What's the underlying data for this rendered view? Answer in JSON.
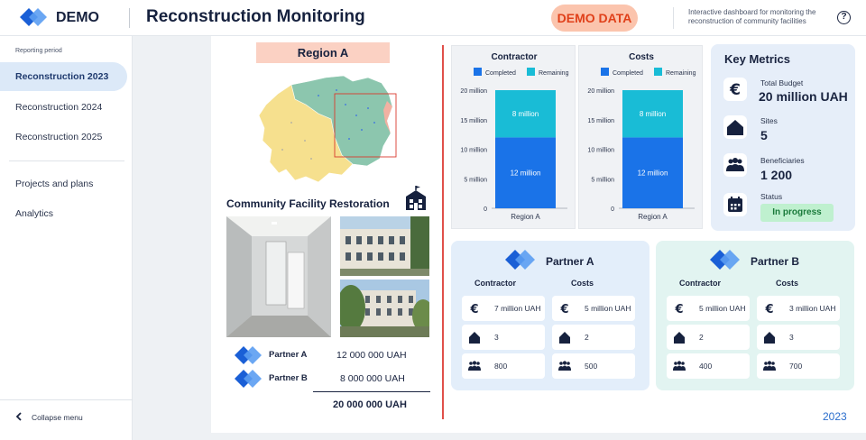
{
  "header": {
    "brand": "DEMO",
    "title": "Reconstruction Monitoring",
    "badge": "DEMO DATA",
    "subtitle": "Interactive dashboard for monitoring the reconstruction of community facilities",
    "help": "?"
  },
  "sidebar": {
    "section_label": "Reporting period",
    "items": [
      {
        "label": "Reconstruction 2023",
        "active": true
      },
      {
        "label": "Reconstruction 2024"
      },
      {
        "label": "Reconstruction 2025"
      }
    ],
    "links": [
      {
        "label": "Projects and plans"
      },
      {
        "label": "Analytics"
      }
    ],
    "collapse_label": "Collapse menu"
  },
  "region": {
    "label": "Region A"
  },
  "facility": {
    "title": "Community Facility Restoration"
  },
  "funding": {
    "rows": [
      {
        "partner": "Partner A",
        "amount": "12 000 000 UAH"
      },
      {
        "partner": "Partner B",
        "amount": "8 000 000 UAH"
      }
    ],
    "total": "20 000 000 UAH"
  },
  "colors": {
    "completed": "#1a73e8",
    "remaining": "#19bcd6",
    "accent": "#2b6ecd",
    "badge": "#e0401a"
  },
  "chart_data": [
    {
      "type": "bar",
      "title": "Contractor",
      "categories": [
        "Region A"
      ],
      "series": [
        {
          "name": "Completed",
          "values": [
            12
          ],
          "labels": [
            "12 million"
          ]
        },
        {
          "name": "Remaining",
          "values": [
            8
          ],
          "labels": [
            "8 million"
          ]
        }
      ],
      "stacked": true,
      "ylim": [
        0,
        20
      ],
      "yticks": [
        "0",
        "5 million",
        "10 million",
        "15 million",
        "20 million"
      ],
      "legend": "top"
    },
    {
      "type": "bar",
      "title": "Costs",
      "categories": [
        "Region A"
      ],
      "series": [
        {
          "name": "Completed",
          "values": [
            12
          ],
          "labels": [
            "12 million"
          ]
        },
        {
          "name": "Remaining",
          "values": [
            8
          ],
          "labels": [
            "8 million"
          ]
        }
      ],
      "stacked": true,
      "ylim": [
        0,
        20
      ],
      "yticks": [
        "0",
        "5 million",
        "10 million",
        "15 million",
        "20 million"
      ],
      "legend": "top"
    }
  ],
  "key_metrics": {
    "title": "Key Metrics",
    "budget_label": "Total Budget",
    "budget": "20 million UAH",
    "sites_label": "Sites",
    "sites": "5",
    "beneficiaries_label": "Beneficiaries",
    "beneficiaries": "1 200",
    "status_label": "Status",
    "status": "In progress"
  },
  "partners": [
    {
      "name": "Partner A",
      "contractor_head": "Contractor",
      "costs_head": "Costs",
      "contractor": {
        "money": "7 million UAH",
        "sites": "3",
        "people": "800"
      },
      "costs": {
        "money": "5 million UAH",
        "sites": "2",
        "people": "500"
      }
    },
    {
      "name": "Partner B",
      "contractor_head": "Contractor",
      "costs_head": "Costs",
      "contractor": {
        "money": "5 million UAH",
        "sites": "2",
        "people": "400"
      },
      "costs": {
        "money": "3 million UAH",
        "sites": "3",
        "people": "700"
      }
    }
  ],
  "footer": {
    "year": "2023"
  },
  "icons": [
    "logo-icon",
    "help-icon",
    "chevron-left-icon",
    "school-icon",
    "euro-icon",
    "house-icon",
    "people-icon",
    "calendar-icon"
  ]
}
